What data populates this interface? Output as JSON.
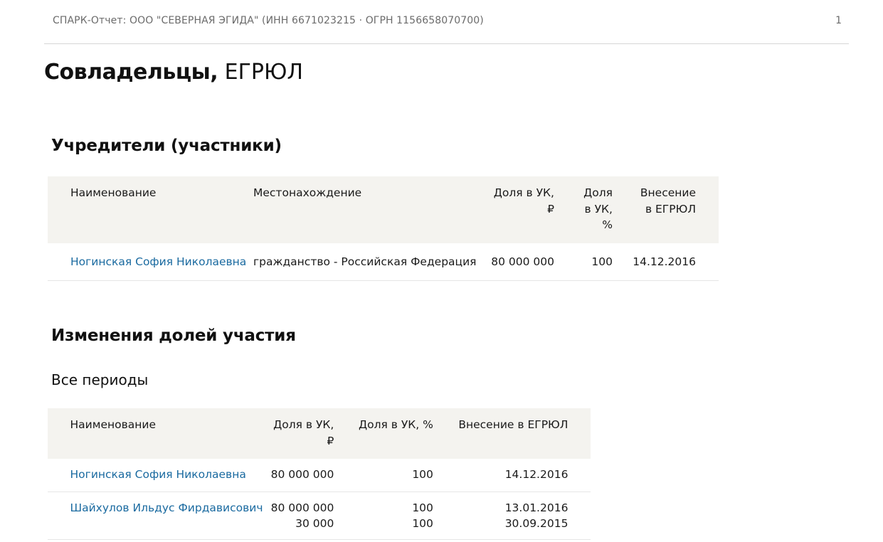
{
  "header": {
    "text": "СПАРК-Отчет: ООО \"СЕВЕРНАЯ ЭГИДА\" (ИНН 6671023215 · ОГРН 1156658070700)",
    "page_number": "1"
  },
  "title": {
    "strong": "Совладельцы,",
    "light": " ЕГРЮЛ"
  },
  "founders": {
    "heading": "Учредители (участники)",
    "columns": {
      "name": "Наименование",
      "location": "Местонахождение",
      "share_rub_1": "Доля в УК,",
      "share_rub_2": "₽",
      "share_pct_1": "Доля",
      "share_pct_2": "в УК,",
      "share_pct_3": "%",
      "egrul_1": "Внесение",
      "egrul_2": "в ЕГРЮЛ"
    },
    "rows": [
      {
        "name": "Ногинская София Николаевна",
        "location": "гражданство - Российская Федерация",
        "share_rub": "80 000 000",
        "share_pct": "100",
        "date": "14.12.2016"
      }
    ]
  },
  "changes": {
    "heading": "Изменения долей участия",
    "subheading": "Все периоды",
    "columns": {
      "name": "Наименование",
      "share_rub_1": "Доля в УК,",
      "share_rub_2": "₽",
      "share_pct": "Доля в УК, %",
      "egrul": "Внесение в ЕГРЮЛ"
    },
    "rows": [
      {
        "name": "Ногинская София Николаевна",
        "share_rub": [
          "80 000 000"
        ],
        "share_pct": [
          "100"
        ],
        "date": [
          "14.12.2016"
        ]
      },
      {
        "name": "Шайхулов Ильдус Фирдависович",
        "share_rub": [
          "80 000 000",
          "30 000"
        ],
        "share_pct": [
          "100",
          "100"
        ],
        "date": [
          "13.01.2016",
          "30.09.2015"
        ]
      }
    ]
  },
  "colors": {
    "link": "#1a6aa0",
    "header_bg": "#f4f3ef",
    "muted_text": "#6b6b6b"
  }
}
